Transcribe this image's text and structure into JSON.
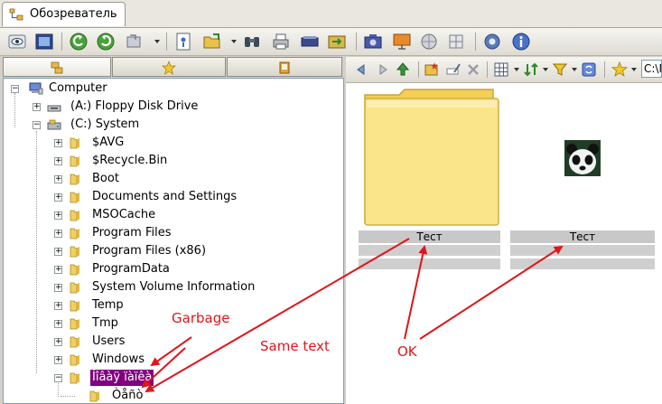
{
  "app": {
    "tab_title": "Обозреватель"
  },
  "toolbar": {
    "icons": [
      "eye-icon",
      "fullscreen-icon",
      "back-icon",
      "forward-icon",
      "refresh-icon",
      "properties-icon",
      "open-folder-icon",
      "binoculars-icon",
      "print-icon",
      "scanner-icon",
      "export-icon",
      "screenshot-icon",
      "slideshow-icon",
      "web-icon",
      "grid-icon",
      "settings-icon",
      "info-icon"
    ]
  },
  "left_tabs": [
    "folders-tab",
    "favorites-tab",
    "catalog-tab"
  ],
  "tree": {
    "root": "Computer",
    "drives": [
      {
        "label": "(A:) Floppy Disk Drive",
        "expanded": false
      },
      {
        "label": "(C:) System",
        "expanded": true
      }
    ],
    "folders": [
      "$AVG",
      "$Recycle.Bin",
      "Boot",
      "Documents and Settings",
      "MSOCache",
      "Program Files",
      "Program Files (x86)",
      "ProgramData",
      "System Volume Information",
      "Temp",
      "Tmp",
      "Users",
      "Windows"
    ],
    "selected_folder": "Íîâàÿ ïàïêà",
    "child_folder": "Òåñò"
  },
  "address": {
    "value": "C:\\N"
  },
  "thumbnails": [
    {
      "caption": "Тест",
      "kind": "folder"
    },
    {
      "caption": "Тест",
      "kind": "image"
    }
  ],
  "annotations": {
    "garbage": "Garbage",
    "same_text": "Same text",
    "ok": "OK",
    "color": "#e0151b"
  },
  "colors": {
    "selection": "#800080",
    "caption_bg": "#c8c8c8",
    "folder_yellow": "#f5d45a"
  }
}
